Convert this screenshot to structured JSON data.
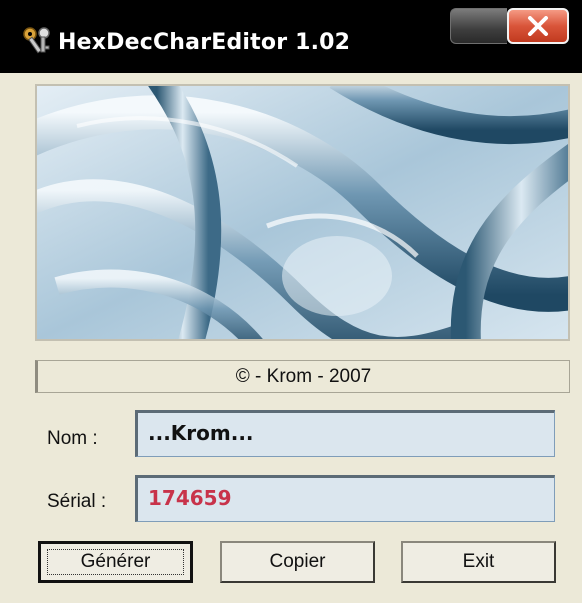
{
  "window": {
    "title": "HexDecCharEditor 1.02",
    "icon": "keys-icon"
  },
  "banner": {
    "image": "abstract-blue-glass-wallpaper"
  },
  "copyright": "© - Krom - 2007",
  "form": {
    "name_label": "Nom :",
    "name_value": "...Krom...",
    "serial_label": "Sérial :",
    "serial_value": "174659"
  },
  "buttons": {
    "generate": "Générer",
    "copy": "Copier",
    "exit": "Exit"
  },
  "colors": {
    "serial_text": "#c8334a",
    "field_background": "#dbe6ee",
    "close_button": "#d9553a"
  }
}
